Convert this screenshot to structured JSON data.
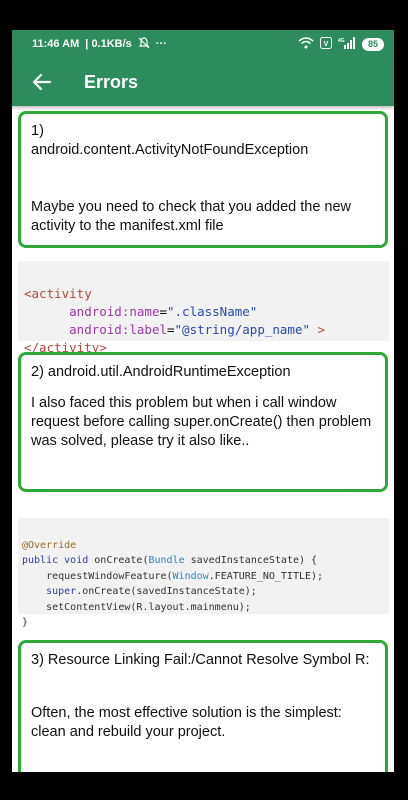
{
  "status": {
    "time": "11:46 AM",
    "network_speed": "0.1KB/s",
    "more": "···",
    "network_type": "4G",
    "battery": "85"
  },
  "appbar": {
    "title": "Errors"
  },
  "cards": [
    {
      "number": "1)",
      "title": "android.content.ActivityNotFoundException",
      "body": "Maybe you need to check that you added the new activity to the manifest.xml file"
    },
    {
      "title": "2) android.util.AndroidRuntimeException",
      "body": "I also faced this problem but when i call window request before calling super.onCreate() then problem was solved, please try it also like.."
    },
    {
      "title": "3) Resource Linking Fail:/Cannot Resolve Symbol R:",
      "body": "Often, the most effective solution is the simplest: clean and rebuild your project."
    }
  ],
  "code1": {
    "open_tag": "<activity",
    "attr1_name": "android:name",
    "attr1_eq": "=",
    "attr1_value": "\".className\"",
    "attr2_name": "android:label",
    "attr2_eq": "=",
    "attr2_value": "\"@string/app_name\"",
    "attr2_end": " >",
    "close_tag": "</activity>"
  },
  "code2": {
    "annotation": "@Override",
    "kw_public": "public",
    "kw_void": "void",
    "method": "onCreate(",
    "param_type": "Bundle",
    "param_rest": " savedInstanceState) {",
    "line3a": "requestWindowFeature(",
    "line3b": "Window",
    "line3c": ".FEATURE_NO_TITLE);",
    "kw_super": "super",
    "line4b": ".onCreate(savedInstanceState);",
    "line5": "setContentView(R.layout.mainmenu);",
    "close": "}"
  }
}
